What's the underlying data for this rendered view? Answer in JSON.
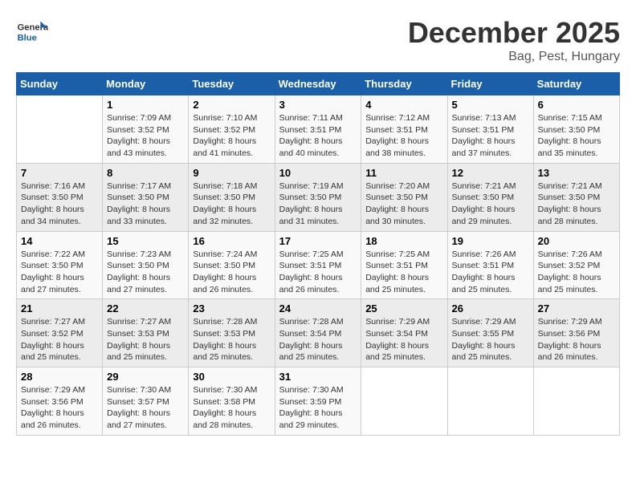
{
  "logo": {
    "line1": "General",
    "line2": "Blue"
  },
  "title": "December 2025",
  "subtitle": "Bag, Pest, Hungary",
  "days_header": [
    "Sunday",
    "Monday",
    "Tuesday",
    "Wednesday",
    "Thursday",
    "Friday",
    "Saturday"
  ],
  "weeks": [
    [
      {
        "day": "",
        "info": ""
      },
      {
        "day": "1",
        "info": "Sunrise: 7:09 AM\nSunset: 3:52 PM\nDaylight: 8 hours\nand 43 minutes."
      },
      {
        "day": "2",
        "info": "Sunrise: 7:10 AM\nSunset: 3:52 PM\nDaylight: 8 hours\nand 41 minutes."
      },
      {
        "day": "3",
        "info": "Sunrise: 7:11 AM\nSunset: 3:51 PM\nDaylight: 8 hours\nand 40 minutes."
      },
      {
        "day": "4",
        "info": "Sunrise: 7:12 AM\nSunset: 3:51 PM\nDaylight: 8 hours\nand 38 minutes."
      },
      {
        "day": "5",
        "info": "Sunrise: 7:13 AM\nSunset: 3:51 PM\nDaylight: 8 hours\nand 37 minutes."
      },
      {
        "day": "6",
        "info": "Sunrise: 7:15 AM\nSunset: 3:50 PM\nDaylight: 8 hours\nand 35 minutes."
      }
    ],
    [
      {
        "day": "7",
        "info": "Sunrise: 7:16 AM\nSunset: 3:50 PM\nDaylight: 8 hours\nand 34 minutes."
      },
      {
        "day": "8",
        "info": "Sunrise: 7:17 AM\nSunset: 3:50 PM\nDaylight: 8 hours\nand 33 minutes."
      },
      {
        "day": "9",
        "info": "Sunrise: 7:18 AM\nSunset: 3:50 PM\nDaylight: 8 hours\nand 32 minutes."
      },
      {
        "day": "10",
        "info": "Sunrise: 7:19 AM\nSunset: 3:50 PM\nDaylight: 8 hours\nand 31 minutes."
      },
      {
        "day": "11",
        "info": "Sunrise: 7:20 AM\nSunset: 3:50 PM\nDaylight: 8 hours\nand 30 minutes."
      },
      {
        "day": "12",
        "info": "Sunrise: 7:21 AM\nSunset: 3:50 PM\nDaylight: 8 hours\nand 29 minutes."
      },
      {
        "day": "13",
        "info": "Sunrise: 7:21 AM\nSunset: 3:50 PM\nDaylight: 8 hours\nand 28 minutes."
      }
    ],
    [
      {
        "day": "14",
        "info": "Sunrise: 7:22 AM\nSunset: 3:50 PM\nDaylight: 8 hours\nand 27 minutes."
      },
      {
        "day": "15",
        "info": "Sunrise: 7:23 AM\nSunset: 3:50 PM\nDaylight: 8 hours\nand 27 minutes."
      },
      {
        "day": "16",
        "info": "Sunrise: 7:24 AM\nSunset: 3:50 PM\nDaylight: 8 hours\nand 26 minutes."
      },
      {
        "day": "17",
        "info": "Sunrise: 7:25 AM\nSunset: 3:51 PM\nDaylight: 8 hours\nand 26 minutes."
      },
      {
        "day": "18",
        "info": "Sunrise: 7:25 AM\nSunset: 3:51 PM\nDaylight: 8 hours\nand 25 minutes."
      },
      {
        "day": "19",
        "info": "Sunrise: 7:26 AM\nSunset: 3:51 PM\nDaylight: 8 hours\nand 25 minutes."
      },
      {
        "day": "20",
        "info": "Sunrise: 7:26 AM\nSunset: 3:52 PM\nDaylight: 8 hours\nand 25 minutes."
      }
    ],
    [
      {
        "day": "21",
        "info": "Sunrise: 7:27 AM\nSunset: 3:52 PM\nDaylight: 8 hours\nand 25 minutes."
      },
      {
        "day": "22",
        "info": "Sunrise: 7:27 AM\nSunset: 3:53 PM\nDaylight: 8 hours\nand 25 minutes."
      },
      {
        "day": "23",
        "info": "Sunrise: 7:28 AM\nSunset: 3:53 PM\nDaylight: 8 hours\nand 25 minutes."
      },
      {
        "day": "24",
        "info": "Sunrise: 7:28 AM\nSunset: 3:54 PM\nDaylight: 8 hours\nand 25 minutes."
      },
      {
        "day": "25",
        "info": "Sunrise: 7:29 AM\nSunset: 3:54 PM\nDaylight: 8 hours\nand 25 minutes."
      },
      {
        "day": "26",
        "info": "Sunrise: 7:29 AM\nSunset: 3:55 PM\nDaylight: 8 hours\nand 25 minutes."
      },
      {
        "day": "27",
        "info": "Sunrise: 7:29 AM\nSunset: 3:56 PM\nDaylight: 8 hours\nand 26 minutes."
      }
    ],
    [
      {
        "day": "28",
        "info": "Sunrise: 7:29 AM\nSunset: 3:56 PM\nDaylight: 8 hours\nand 26 minutes."
      },
      {
        "day": "29",
        "info": "Sunrise: 7:30 AM\nSunset: 3:57 PM\nDaylight: 8 hours\nand 27 minutes."
      },
      {
        "day": "30",
        "info": "Sunrise: 7:30 AM\nSunset: 3:58 PM\nDaylight: 8 hours\nand 28 minutes."
      },
      {
        "day": "31",
        "info": "Sunrise: 7:30 AM\nSunset: 3:59 PM\nDaylight: 8 hours\nand 29 minutes."
      },
      {
        "day": "",
        "info": ""
      },
      {
        "day": "",
        "info": ""
      },
      {
        "day": "",
        "info": ""
      }
    ]
  ]
}
